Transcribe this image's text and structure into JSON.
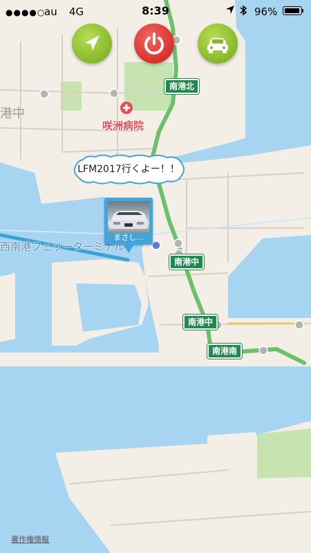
{
  "status_bar": {
    "signal": "●●●●○",
    "carrier": "au",
    "network": "4G",
    "time": "8:39",
    "battery": "96%",
    "battery_level": 0.96,
    "location_icon": "location-arrow-icon",
    "bluetooth_icon": "bluetooth-icon"
  },
  "toolbar": {
    "navigate_icon": "navigation-arrow-icon",
    "power_icon": "power-icon",
    "car_icon": "car-icon"
  },
  "map": {
    "road_labels": [
      "南港北",
      "南港中",
      "南港中",
      "南港南"
    ],
    "poi_label": "咲洲病院",
    "area_label": "港中",
    "ferry_label": "西南港フェリーターミナル",
    "colors": {
      "water": "#a7d4f0",
      "land": "#f3eee6",
      "park": "#c7e3b0",
      "road": "#6cc06c",
      "route": "#3aa4d6"
    }
  },
  "callout": {
    "message": "LFM2017行くよー！！"
  },
  "car_pin": {
    "name": "まさし..."
  },
  "credit": "著作権情報"
}
